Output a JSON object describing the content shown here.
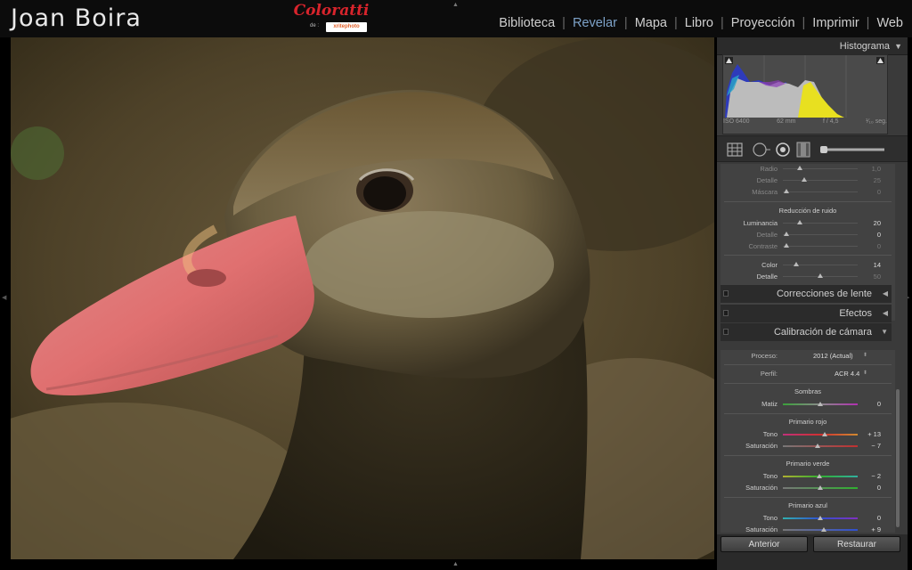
{
  "identity": "Joan Boira",
  "brand": {
    "name": "Coloratti",
    "sub": "de :",
    "logo": "xritephoto"
  },
  "modules": [
    {
      "label": "Biblioteca",
      "active": false
    },
    {
      "label": "Revelar",
      "active": true
    },
    {
      "label": "Mapa",
      "active": false
    },
    {
      "label": "Libro",
      "active": false
    },
    {
      "label": "Proyección",
      "active": false
    },
    {
      "label": "Imprimir",
      "active": false
    },
    {
      "label": "Web",
      "active": false
    }
  ],
  "histogram": {
    "title": "Histograma",
    "iso": "ISO 6400",
    "focal": "62 mm",
    "aperture": "f / 4,5",
    "shutter": "¹⁄₁₀ seg."
  },
  "detail": {
    "sharpen": [
      {
        "label": "Radio",
        "value": "1,0"
      },
      {
        "label": "Detalle",
        "value": "25"
      },
      {
        "label": "Máscara",
        "value": "0"
      }
    ],
    "noise_title": "Reducción de ruido",
    "noise": [
      {
        "label": "Luminancia",
        "value": "20"
      },
      {
        "label": "Detalle",
        "value": "0"
      },
      {
        "label": "Contraste",
        "value": "0"
      }
    ],
    "color": [
      {
        "label": "Color",
        "value": "14"
      },
      {
        "label": "Detalle",
        "value": "50"
      }
    ]
  },
  "panels": {
    "lens": "Correcciones de lente",
    "effects": "Efectos",
    "calibration": "Calibración de cámara"
  },
  "calibration": {
    "process_label": "Proceso:",
    "process_value": "2012 (Actual)",
    "profile_label": "Perfil:",
    "profile_value": "ACR 4.4",
    "shadows_title": "Sombras",
    "shadows_tint_label": "Matiz",
    "shadows_tint_value": "0",
    "red_title": "Primario rojo",
    "red_hue_label": "Tono",
    "red_hue_value": "+ 13",
    "red_sat_label": "Saturación",
    "red_sat_value": "− 7",
    "green_title": "Primario verde",
    "green_hue_label": "Tono",
    "green_hue_value": "− 2",
    "green_sat_label": "Saturación",
    "green_sat_value": "0",
    "blue_title": "Primario azul",
    "blue_hue_label": "Tono",
    "blue_hue_value": "0",
    "blue_sat_label": "Saturación",
    "blue_sat_value": "+ 9"
  },
  "footer": {
    "previous": "Anterior",
    "reset": "Restaurar"
  }
}
